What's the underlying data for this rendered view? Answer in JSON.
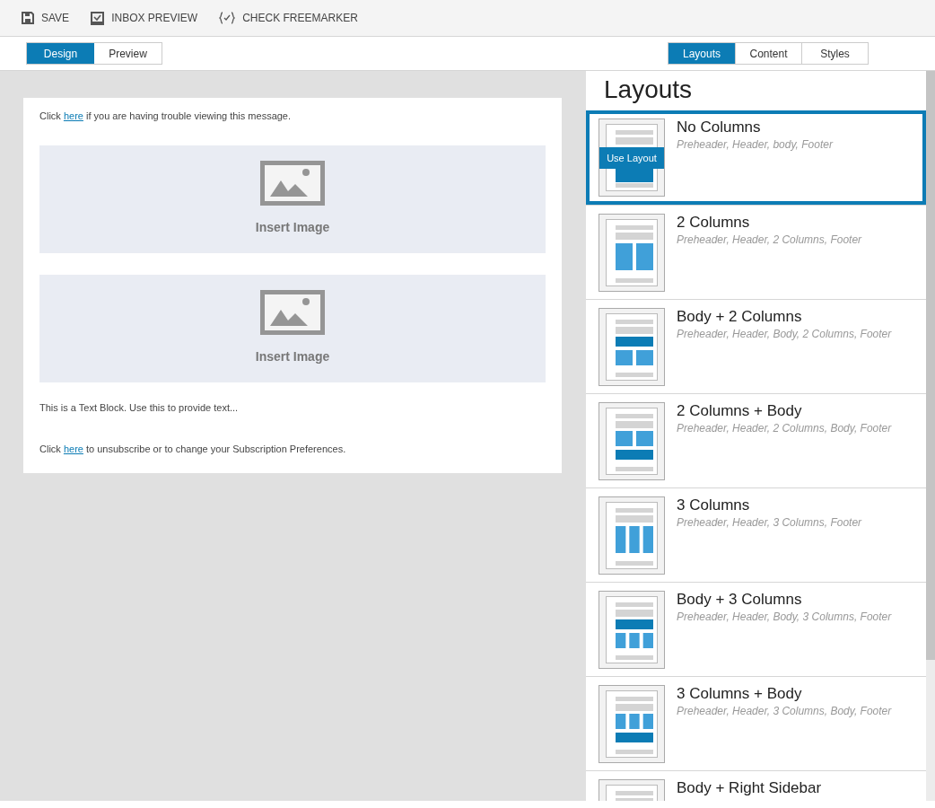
{
  "toolbar": [
    {
      "kind": "save",
      "label": "SAVE"
    },
    {
      "kind": "inbox",
      "label": "INBOX PREVIEW"
    },
    {
      "kind": "freemarker",
      "label": "CHECK FREEMARKER"
    }
  ],
  "mode_tabs": [
    {
      "label": "Design",
      "selected": true
    },
    {
      "label": "Preview",
      "selected": false
    }
  ],
  "panel_tabs": [
    {
      "label": "Layouts",
      "selected": true
    },
    {
      "label": "Content",
      "selected": false
    },
    {
      "label": "Styles",
      "selected": false
    }
  ],
  "email": {
    "top_line": {
      "before": "Click ",
      "link": "here",
      "after": " if you are having trouble viewing this message."
    },
    "image_blocks": [
      {
        "label": "Insert Image"
      },
      {
        "label": "Insert Image"
      }
    ],
    "text_block": "This is a Text Block. Use this to provide text...",
    "footer_line": {
      "before": "Click ",
      "link": "here",
      "after": " to unsubscribe or to change your Subscription Preferences."
    }
  },
  "panel": {
    "title": "Layouts",
    "action_label": "Use Layout",
    "layouts": [
      {
        "kind": "none",
        "name": "No Columns",
        "parts": "Preheader, Header, body, Footer",
        "selected": true
      },
      {
        "kind": "two",
        "name": "2 Columns",
        "parts": "Preheader, Header, 2 Columns, Footer",
        "selected": false
      },
      {
        "kind": "body-two",
        "name": "Body + 2 Columns",
        "parts": "Preheader, Header, Body, 2 Columns, Footer",
        "selected": false
      },
      {
        "kind": "two-body",
        "name": "2 Columns + Body",
        "parts": "Preheader, Header, 2 Columns, Body, Footer",
        "selected": false
      },
      {
        "kind": "three",
        "name": "3 Columns",
        "parts": "Preheader, Header, 3 Columns, Footer",
        "selected": false
      },
      {
        "kind": "body-three",
        "name": "Body + 3 Columns",
        "parts": "Preheader, Header, Body, 3 Columns, Footer",
        "selected": false
      },
      {
        "kind": "three-body",
        "name": "3 Columns + Body",
        "parts": "Preheader, Header, 3 Columns, Body, Footer",
        "selected": false
      },
      {
        "kind": "sidebar",
        "name": "Body + Right Sidebar",
        "selected": false
      }
    ]
  }
}
